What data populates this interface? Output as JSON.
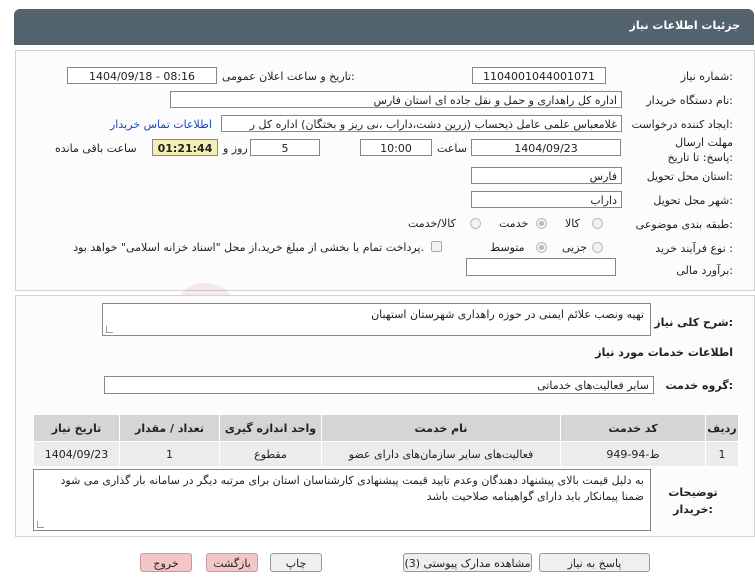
{
  "header": {
    "title": "جزئیات اطلاعات نیاز"
  },
  "form": {
    "need_number_label": "شماره نیاز:",
    "need_number": "1104001044001071",
    "announce_label": "تاریخ و ساعت اعلان عمومی:",
    "announce_value": "1404/09/18 - 08:16",
    "buyer_label": "نام دستگاه خریدار:",
    "buyer_value": "اداره کل راهداری و حمل و نقل جاده ای استان فارس",
    "creator_label": "ایجاد کننده درخواست:",
    "creator_value": "غلامعباس علمی عامل ذیحساب (زرین دشت،داراب ،نی ریز و بختگان) اداره کل ر",
    "contact_link": "اطلاعات تماس خریدار",
    "deadline_label": "مهلت ارسال پاسخ: تا تاریخ:",
    "deadline_date": "1404/09/23",
    "time_label": "ساعت",
    "deadline_time": "10:00",
    "days_value": "5",
    "days_label": "روز و",
    "timer": "01:21:44",
    "remaining_label": "ساعت باقی مانده",
    "province_label": "استان محل تحویل:",
    "province_value": "فارس",
    "city_label": "شهر محل تحویل:",
    "city_value": "داراب",
    "category_label": "طبقه بندی موضوعی:",
    "category_options": [
      "کالا",
      "خدمت",
      "کالا/خدمت"
    ],
    "category_selected": "خدمت",
    "process_label": "نوع فرآیند خرید :",
    "process_options": [
      "جزیی",
      "متوسط"
    ],
    "process_selected": "متوسط",
    "payment_note": "پرداخت تمام یا بخشی از مبلغ خرید،از محل \"اسناد خزانه اسلامی\" خواهد بود.",
    "estimate_label": "برآورد مالی:",
    "estimate_value": ""
  },
  "details": {
    "summary_label": "شرح کلی نیاز:",
    "summary_value": "تهیه ونصب علائم ایمنی در حوزه راهداری شهرستان استهبان",
    "services_heading": "اطلاعات خدمات مورد نیاز",
    "group_label": "گروه خدمت:",
    "group_value": "سایر فعالیت‌های خدماتی",
    "table": {
      "headers": [
        "ردیف",
        "کد خدمت",
        "نام خدمت",
        "واحد اندازه گیری",
        "تعداد / مقدار",
        "تاریخ نیاز"
      ],
      "rows": [
        [
          "1",
          "ط-94-949",
          "فعالیت‌های سایر سازمان‌های دارای عضو",
          "مقطوع",
          "1",
          "1404/09/23"
        ]
      ]
    },
    "notes_label": "توضیحات خریدار:",
    "notes_value": "به دلیل قیمت بالای پیشنهاد دهندگان وعدم تایید قیمت پیشنهادی کارشناسان استان برای مرتبه دیگر در سامانه بار گذاری می شود ضمنا پیمانکار باید دارای گواهینامه صلاحیت باشد"
  },
  "buttons": {
    "reply": "پاسخ به نیاز",
    "docs": "مشاهده مدارک پیوستی (3)",
    "print": "چاپ",
    "back": "بازگشت",
    "exit": "خروج"
  },
  "watermark": {
    "text": "AriaTender.net"
  },
  "colors": {
    "header": "#53636d",
    "timer_bg": "#f4f0b4",
    "link": "#1a44c0",
    "exit_bg": "#f5c6c6"
  }
}
